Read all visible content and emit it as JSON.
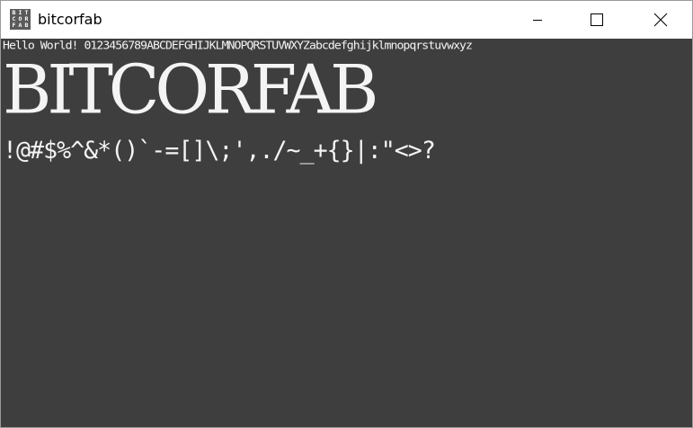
{
  "window": {
    "title": "bitcorfab",
    "icon_letters": [
      "B",
      "I",
      "T",
      "C",
      "O",
      "R",
      "F",
      "A",
      "B"
    ],
    "icon": "bitcorfab-app-icon",
    "controls": {
      "minimize_icon": "minimize-icon",
      "maximize_icon": "maximize-icon",
      "close_icon": "close-icon"
    }
  },
  "content": {
    "background": "#3e3e3e",
    "text_color": "#f4f4f4",
    "line_small": "Hello World! 0123456789ABCDEFGHIJKLMNOPQRSTUVWXYZabcdefghijklmnopqrstuvwxyz",
    "line_big": "BITCORFAB",
    "line_symbols": "!@#$%^&*()`-=[]\\;',./~_+{}|:\"<>?"
  }
}
